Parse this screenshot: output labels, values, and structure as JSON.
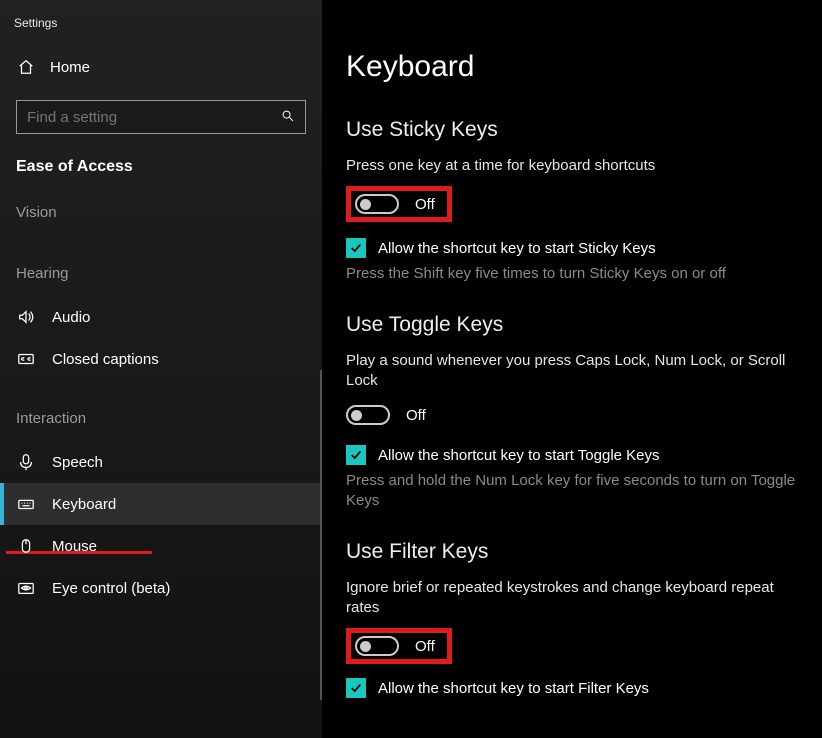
{
  "app_title": "Settings",
  "sidebar": {
    "home": "Home",
    "search_placeholder": "Find a setting",
    "category": "Ease of Access",
    "groups": {
      "vision": "Vision",
      "hearing": "Hearing",
      "interaction": "Interaction"
    },
    "items": {
      "audio": "Audio",
      "closed_captions": "Closed captions",
      "speech": "Speech",
      "keyboard": "Keyboard",
      "mouse": "Mouse",
      "eye_control": "Eye control (beta)"
    }
  },
  "page": {
    "title": "Keyboard",
    "sticky": {
      "heading": "Use Sticky Keys",
      "desc": "Press one key at a time for keyboard shortcuts",
      "toggle": "Off",
      "check": "Allow the shortcut key to start Sticky Keys",
      "sub": "Press the Shift key five times to turn Sticky Keys on or off"
    },
    "toggle": {
      "heading": "Use Toggle Keys",
      "desc": "Play a sound whenever you press Caps Lock, Num Lock, or Scroll Lock",
      "toggle": "Off",
      "check": "Allow the shortcut key to start Toggle Keys",
      "sub": "Press and hold the Num Lock key for five seconds to turn on Toggle Keys"
    },
    "filter": {
      "heading": "Use Filter Keys",
      "desc": "Ignore brief or repeated keystrokes and change keyboard repeat rates",
      "toggle": "Off",
      "check": "Allow the shortcut key to start Filter Keys"
    }
  }
}
